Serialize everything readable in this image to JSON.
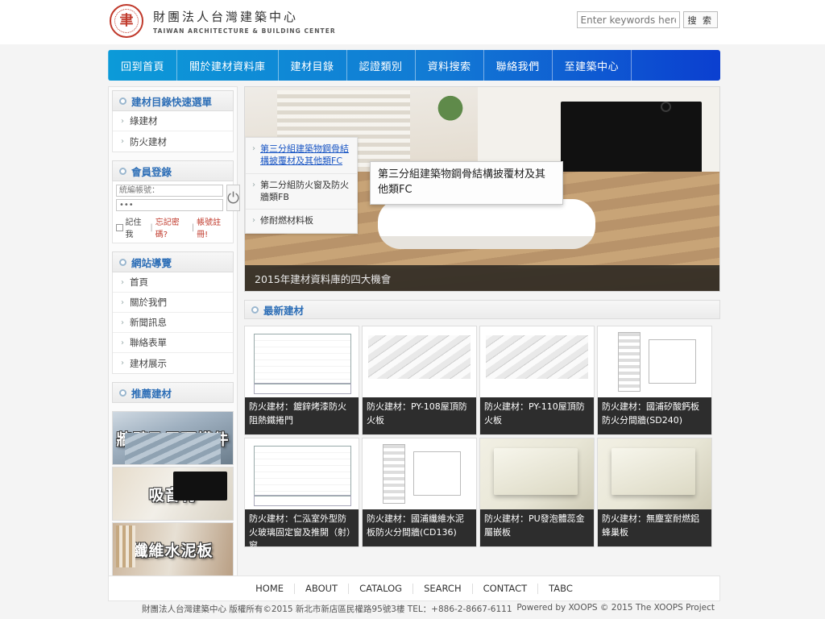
{
  "header": {
    "brand_cn": "財團法人台灣建築中心",
    "brand_en": "TAIWAN ARCHITECTURE & BUILDING CENTER",
    "logo_glyph": "聿",
    "search_placeholder": "Enter keywords here!",
    "search_value": "",
    "search_button": "搜 索"
  },
  "nav": {
    "items": [
      {
        "label": "回到首頁"
      },
      {
        "label": "關於建材資料庫"
      },
      {
        "label": "建材目錄"
      },
      {
        "label": "認證類別"
      },
      {
        "label": "資料搜索"
      },
      {
        "label": "聯絡我們"
      },
      {
        "label": "至建築中心"
      }
    ]
  },
  "sidebar": {
    "quick_menu": {
      "title": "建材目錄快速選單",
      "items": [
        {
          "label": "綠建材"
        },
        {
          "label": "防火建材"
        }
      ]
    },
    "login": {
      "title": "會員登錄",
      "user_placeholder": "統編帳號：",
      "user_value": "",
      "password_value": "•••",
      "remember_label": "記住我",
      "sep1": "|",
      "forgot_label": "忘記密碼?",
      "sep2": "|",
      "register_label": "帳號註冊!",
      "submit_icon": "⏻"
    },
    "site_nav": {
      "title": "網站導覽",
      "items": [
        {
          "label": "首頁"
        },
        {
          "label": "關於我們"
        },
        {
          "label": "新聞訊息"
        },
        {
          "label": "聯絡表單"
        },
        {
          "label": "建材展示"
        }
      ]
    },
    "recommend": {
      "title": "推薦建材",
      "items": [
        {
          "label": "牆壁及屋頂構件"
        },
        {
          "label": "吸音材"
        },
        {
          "label": "纖維水泥板"
        }
      ]
    }
  },
  "submenu": {
    "items": [
      {
        "label": "第三分組建築物鋼骨結構披覆材及其他類FC",
        "active": true
      },
      {
        "label": "第二分組防火窗及防火牆類FB",
        "active": false
      },
      {
        "label": "修耐燃材料板",
        "active": false
      }
    ],
    "tooltip": "第三分組建築物鋼骨結構披覆材及其他類FC"
  },
  "banner": {
    "caption": "2015年建材資料庫的四大機會"
  },
  "latest": {
    "title": "最新建材",
    "cards": [
      {
        "caption": "防火建材：鍍鋅烤漆防火阻熱鐵捲門",
        "img": "blueprint-plan"
      },
      {
        "caption": "防火建材：PY-108屋頂防火板",
        "img": "isometric-drawing"
      },
      {
        "caption": "防火建材：PY-110屋頂防火板",
        "img": "isometric-drawing"
      },
      {
        "caption": "防火建材：國浦矽酸鈣板防火分間牆(SD240)",
        "img": "section-drawing"
      },
      {
        "caption": "防火建材：仁泓室外型防火玻璃固定窗及推開（射）窗",
        "img": "blueprint-plan"
      },
      {
        "caption": "防火建材：國浦纖維水泥板防火分間牆(CD136)",
        "img": "section-drawing"
      },
      {
        "caption": "防火建材：PU發泡體蕊金屬嵌板",
        "img": "product-photo"
      },
      {
        "caption": "防火建材：無塵室耐燃鋁蜂巢板",
        "img": "product-photo"
      }
    ]
  },
  "footer": {
    "links": [
      {
        "label": "HOME"
      },
      {
        "label": "ABOUT"
      },
      {
        "label": "CATALOG"
      },
      {
        "label": "SEARCH"
      },
      {
        "label": "CONTACT"
      },
      {
        "label": "TABC"
      }
    ],
    "copyright": "財團法人台灣建築中心 版權所有©2015 新北市新店區民權路95號3樓 TEL：+886-2-8667-6111",
    "powered": "Powered by XOOPS © 2015 The XOOPS Project"
  },
  "colors": {
    "nav_start": "#0c9ad8",
    "nav_end": "#0b3fd0",
    "heading": "#2e6fb7",
    "brand_red": "#c0392b",
    "caption_bg": "#2d2d2d"
  }
}
